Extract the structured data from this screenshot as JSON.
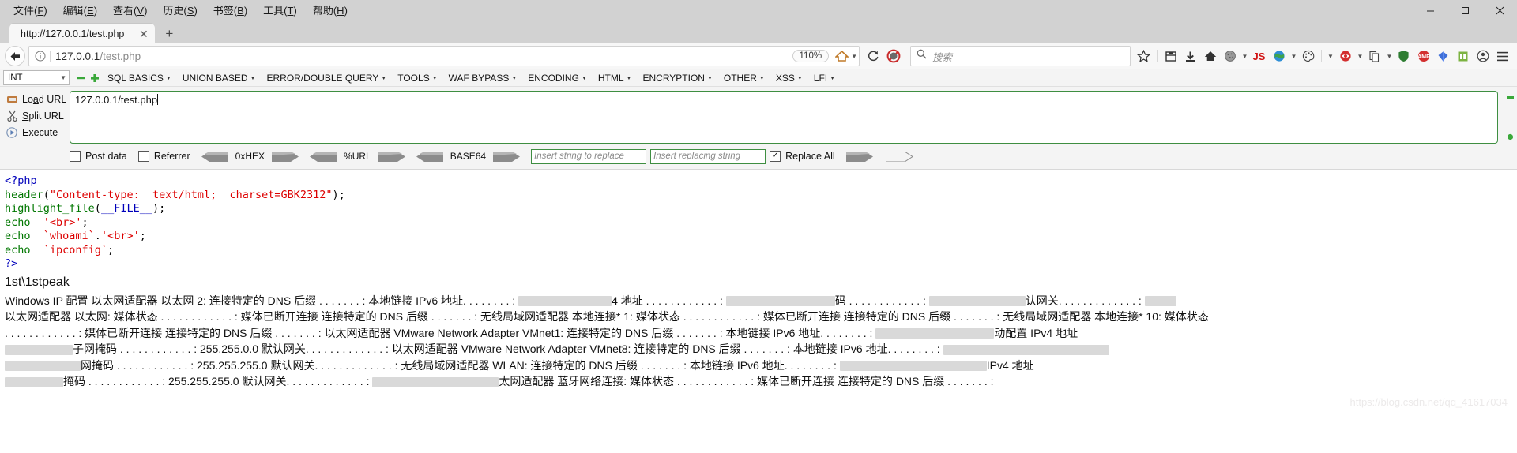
{
  "window": {
    "menus": [
      {
        "label": "文件",
        "mnemonic": "F"
      },
      {
        "label": "编辑",
        "mnemonic": "E"
      },
      {
        "label": "查看",
        "mnemonic": "V"
      },
      {
        "label": "历史",
        "mnemonic": "S"
      },
      {
        "label": "书签",
        "mnemonic": "B"
      },
      {
        "label": "工具",
        "mnemonic": "T"
      },
      {
        "label": "帮助",
        "mnemonic": "H"
      }
    ],
    "controls": {
      "minimize": "minimize-button",
      "maximize": "maximize-button",
      "close": "close-button"
    }
  },
  "tabs": {
    "items": [
      {
        "title": "http://127.0.0.1/test.php",
        "active": true
      }
    ],
    "close_label": "✕",
    "newtab_label": "+"
  },
  "navbar": {
    "back": "back-button",
    "url_scheme": "127.0.0.1",
    "url_path": "/test.php",
    "zoom_level": "110%",
    "reader_icon": "reader-mode-icon",
    "reload_icon": "reload-button",
    "block_icon": "noscript-icon",
    "search_placeholder": "搜索",
    "icons": [
      "bookmark-star-icon",
      "library-icon",
      "downloads-icon",
      "home-icon",
      "cookie-manager-icon",
      "js-toggle-icon",
      "proxy-icon",
      "palette-icon",
      "user-agent-icon",
      "copy-icon",
      "shield-icon",
      "amp-icon",
      "gem-icon",
      "grid-icon",
      "account-icon",
      "hamburger-menu-icon"
    ]
  },
  "hackbar": {
    "type_select": "INT",
    "minus": "▬",
    "plus": "✚",
    "menus": [
      "SQL BASICS",
      "UNION BASED",
      "ERROR/DOUBLE QUERY",
      "TOOLS",
      "WAF BYPASS",
      "ENCODING",
      "HTML",
      "ENCRYPTION",
      "OTHER",
      "XSS",
      "LFI"
    ],
    "actions": [
      {
        "label": "Lo",
        "mn": "a",
        "rest": "d URL",
        "icon": "load-url-icon"
      },
      {
        "label": "",
        "mn": "S",
        "rest": "plit URL",
        "icon": "split-url-icon"
      },
      {
        "label": "E",
        "mn": "x",
        "rest": "ecute",
        "icon": "execute-icon"
      }
    ],
    "url_value": "127.0.0.1/test.php",
    "options": {
      "post_data": {
        "label": "Post data",
        "checked": false
      },
      "referrer": {
        "label": "Referrer",
        "checked": false
      },
      "hex": "0xHEX",
      "url_enc": "%URL",
      "base64": "BASE64",
      "find_placeholder": "Insert string to replace",
      "replace_placeholder": "Insert replacing string",
      "replace_all": {
        "label": "Replace All",
        "checked": true
      }
    }
  },
  "page": {
    "code_lines": [
      [
        {
          "t": "<?php",
          "c": "c-blue"
        }
      ],
      [
        {
          "t": "header",
          "c": "c-green"
        },
        {
          "t": "(",
          "c": "c-black"
        },
        {
          "t": "\"Content-type:  text/html;  charset=GBK2312\"",
          "c": "c-red"
        },
        {
          "t": ")",
          "c": "c-black"
        },
        {
          "t": ";",
          "c": "c-black"
        }
      ],
      [
        {
          "t": "highlight_file",
          "c": "c-green"
        },
        {
          "t": "(",
          "c": "c-black"
        },
        {
          "t": "__FILE__",
          "c": "c-blue"
        },
        {
          "t": ")",
          "c": "c-black"
        },
        {
          "t": ";",
          "c": "c-black"
        }
      ],
      [
        {
          "t": "echo ",
          "c": "c-green"
        },
        {
          "t": " '<br>'",
          "c": "c-red"
        },
        {
          "t": ";",
          "c": "c-black"
        }
      ],
      [
        {
          "t": "echo ",
          "c": "c-green"
        },
        {
          "t": " `whoami`",
          "c": "c-red"
        },
        {
          "t": ".",
          "c": "c-black"
        },
        {
          "t": "'<br>'",
          "c": "c-red"
        },
        {
          "t": ";",
          "c": "c-black"
        }
      ],
      [
        {
          "t": "echo ",
          "c": "c-green"
        },
        {
          "t": " `ipconfig`",
          "c": "c-red"
        },
        {
          "t": ";",
          "c": "c-black"
        }
      ],
      [
        {
          "t": "?>",
          "c": "c-blue"
        }
      ]
    ],
    "whoami_output": "1st\\1stpeak",
    "ipconfig_lines": [
      [
        {
          "t": "Windows IP 配置 以太网适配器 以太网 2: 连接特定的 DNS 后缀 . . . . . . . : 本地链接 IPv6 地址. . . . . . . . : "
        },
        {
          "b": 118
        },
        {
          "t": "4 地址 . . . . . . . . . . . . : "
        },
        {
          "b": 138
        },
        {
          "t": "码 . . . . . . . . . . . . : "
        },
        {
          "b": 122
        },
        {
          "t": "认网关. . . . . . . . . . . . . : "
        },
        {
          "b": 40
        }
      ],
      [
        {
          "t": "以太网适配器 以太网: 媒体状态  . . . . . . . . . . . . : 媒体已断开连接 连接特定的 DNS 后缀 . . . . . . . : 无线局域网适配器 本地连接* 1: 媒体状态  . . . . . . . . . . . . : 媒体已断开连接 连接特定的 DNS 后缀 . . . . . . . : 无线局域网适配器 本地连接* 10: 媒体状态"
        }
      ],
      [
        {
          "t": ". . . . . . . . . . . . : 媒体已断开连接 连接特定的 DNS 后缀 . . . . . . . : 以太网适配器 VMware Network Adapter VMnet1: 连接特定的 DNS 后缀 . . . . . . . : 本地链接 IPv6 地址. . . . . . . . : "
        },
        {
          "b": 150
        },
        {
          "t": "动配置 IPv4 地址"
        }
      ],
      [
        {
          "b": 86
        },
        {
          "t": "子网掩码  . . . . . . . . . . . . : 255.255.0.0 默认网关. . . . . . . . . . . . . : 以太网适配器 VMware Network Adapter VMnet8: 连接特定的 DNS 后缀 . . . . . . . : 本地链接 IPv6 地址. . . . . . . . : "
        },
        {
          "b": 210
        }
      ],
      [
        {
          "b": 96
        },
        {
          "t": "网掩码  . . . . . . . . . . . . : 255.255.255.0 默认网关. . . . . . . . . . . . . : 无线局域网适配器 WLAN: 连接特定的 DNS 后缀 . . . . . . . : 本地链接 IPv6 地址. . . . . . . . : "
        },
        {
          "b": 186
        },
        {
          "t": "IPv4 地址"
        }
      ],
      [
        {
          "b": 74
        },
        {
          "t": "掩码  . . . . . . . . . . . . : 255.255.255.0 默认网关. . . . . . . . . . . . . : "
        },
        {
          "b": 160
        },
        {
          "t": "太网适配器 蓝牙网络连接: 媒体状态  . . . . . . . . . . . . : 媒体已断开连接 连接特定的 DNS 后缀 . . . . . . . : "
        }
      ]
    ],
    "watermark": "https://blog.csdn.net/qq_41617034"
  },
  "colors": {
    "accent_green": "#3e8e41",
    "titlebar": "#d2d2d2",
    "toolbar": "#f7f7f7",
    "hackbar_bg": "#f4f4f4",
    "code_keyword": "#0000bb",
    "code_function": "#007700",
    "code_string": "#dd0000"
  }
}
